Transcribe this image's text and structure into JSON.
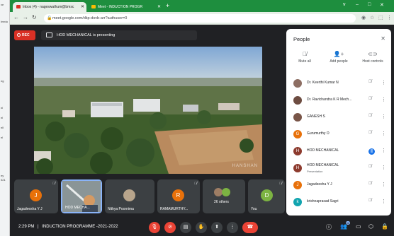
{
  "left_window": {
    "labels": [
      "ve",
      "Inedu",
      "ng",
      "nl",
      "nl",
      "nll",
      "nl",
      "ey",
      "021"
    ]
  },
  "browser": {
    "tabs": [
      {
        "label": "Inbox (4) - nageswathum@bmsc",
        "active": true
      },
      {
        "label": "Meet - INDUCTION PROGR",
        "active": false
      }
    ],
    "new_tab": "+",
    "window_controls": [
      "v",
      "–",
      "□",
      "✕"
    ],
    "url": "meet.google.com/dkp-dsvb-arr?authuser=0"
  },
  "meet": {
    "rec_label": "REC",
    "presenting_text": "HOD MECHANICAL is presenting",
    "video_watermark": "HANSHAN",
    "tiles": [
      {
        "initial": "J",
        "name": "Jagadeesha Y J",
        "color": "#e8710a"
      },
      {
        "initial": "",
        "name": "HOD MECHA...",
        "color": ""
      },
      {
        "initial": "",
        "name": "Nithya Poornima",
        "color": ""
      },
      {
        "initial": "R",
        "name": "RAMAMURTHY...",
        "color": "#e8710a"
      },
      {
        "initial": "",
        "name": "26 others",
        "color": ""
      },
      {
        "initial": "D",
        "name": "You",
        "color": "#7cb342"
      }
    ],
    "bottom": {
      "time": "2:29 PM",
      "separator": "|",
      "meeting_name": "INDUCTION PROGRAMME -2021-2022",
      "participant_count": "32"
    }
  },
  "people_panel": {
    "title": "People",
    "actions": [
      {
        "label": "Mute all"
      },
      {
        "label": "Add people"
      },
      {
        "label": "Host controls"
      }
    ],
    "participants": [
      {
        "initial": "",
        "name": "Dr. Keerthi Kumar N",
        "sub": "",
        "color": "#8d6e63",
        "speaking": false
      },
      {
        "initial": "",
        "name": "Dr. Ravichandra K R Mech...",
        "sub": "",
        "color": "#6d4c41",
        "speaking": false
      },
      {
        "initial": "",
        "name": "GANESH S",
        "sub": "",
        "color": "#795548",
        "speaking": false
      },
      {
        "initial": "G",
        "name": "Gurumurthy O",
        "sub": "",
        "color": "#e8710a",
        "speaking": false
      },
      {
        "initial": "H",
        "name": "HOD MECHANICAL",
        "sub": "",
        "color": "#8d3b2e",
        "speaking": true
      },
      {
        "initial": "H",
        "name": "HOD MECHANICAL",
        "sub": "Presentation",
        "color": "#8d3b2e",
        "speaking": false
      },
      {
        "initial": "J",
        "name": "Jagadeesha Y J",
        "sub": "",
        "color": "#e8710a",
        "speaking": false
      },
      {
        "initial": "k",
        "name": "krishnaprasad Sagri",
        "sub": "",
        "color": "#12a4af",
        "speaking": false
      }
    ]
  }
}
